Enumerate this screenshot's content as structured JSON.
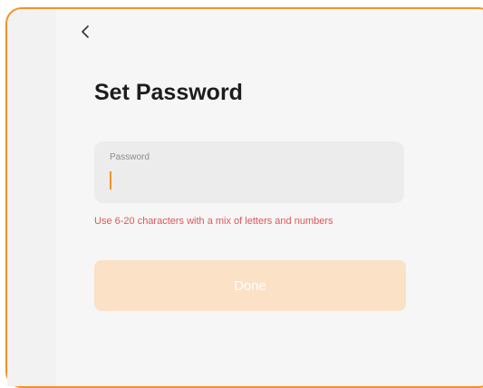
{
  "header": {
    "back_icon": "chevron-left-icon"
  },
  "page": {
    "title": "Set Password"
  },
  "password": {
    "label": "Password",
    "value": "",
    "placeholder": ""
  },
  "hint": {
    "text": "Use 6-20 characters with a mix of letters and numbers"
  },
  "actions": {
    "done_label": "Done"
  },
  "colors": {
    "accent": "#f0922b",
    "error": "#e05555",
    "button_disabled": "#fbe1c6",
    "input_bg": "#ececec",
    "background": "#f6f6f6"
  }
}
